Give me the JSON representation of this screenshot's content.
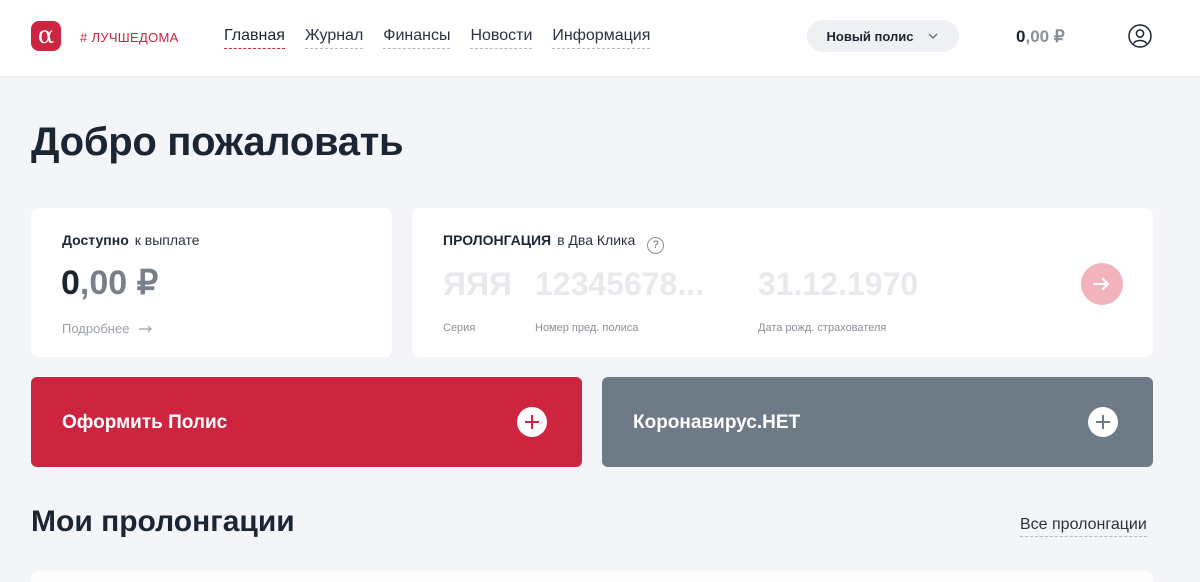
{
  "header": {
    "logo_glyph": "α",
    "tagline": "# ЛУЧШЕДОМА",
    "nav": [
      {
        "label": "Главная",
        "active": true
      },
      {
        "label": "Журнал",
        "active": false
      },
      {
        "label": "Финансы",
        "active": false
      },
      {
        "label": "Новости",
        "active": false
      },
      {
        "label": "Информация",
        "active": false
      }
    ],
    "policy_select_label": "Новый полис",
    "balance_int": "0",
    "balance_rest": ",00 ₽"
  },
  "main": {
    "title": "Добро пожаловать",
    "available": {
      "label_bold": "Доступно",
      "label_rest": "к выплате",
      "amount_int": "0",
      "amount_rest": ",00 ₽",
      "details_link": "Подробнее"
    },
    "prolongation": {
      "label_bold": "ПРОЛОНГАЦИЯ",
      "label_rest": "в Два Клика",
      "help_glyph": "?",
      "fields": [
        {
          "value": "ЯЯЯ",
          "label": "Серия"
        },
        {
          "value": "12345678...",
          "label": "Номер пред. полиса"
        },
        {
          "value": "31.12.1970",
          "label": "Дата рожд. страхователя"
        }
      ]
    },
    "actions": [
      {
        "label": "Оформить Полис"
      },
      {
        "label": "Коронавирус.НЕТ"
      }
    ],
    "section_title": "Мои пролонгации",
    "all_link": "Все пролонгации"
  },
  "colors": {
    "brand_red": "#cd2540",
    "slate": "#6f7a87",
    "background": "#f4f5f8",
    "text": "#1c2633"
  }
}
